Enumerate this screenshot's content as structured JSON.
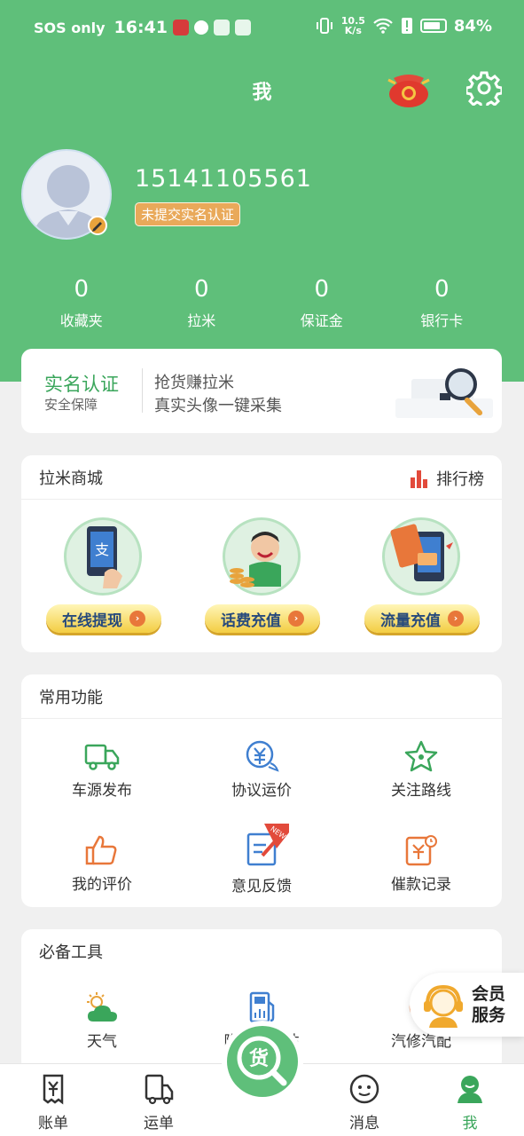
{
  "status_bar": {
    "sos": "SOS only",
    "time": "16:41",
    "net_speed_value": "10.5",
    "net_speed_unit": "K/s",
    "battery_pct": "84%",
    "battery_level": 0.84
  },
  "header": {
    "title": "我"
  },
  "profile": {
    "phone": "15141105561",
    "verify_badge": "未提交实名认证"
  },
  "stats": [
    {
      "value": "0",
      "label": "收藏夹"
    },
    {
      "value": "0",
      "label": "拉米"
    },
    {
      "value": "0",
      "label": "保证金"
    },
    {
      "value": "0",
      "label": "银行卡"
    }
  ],
  "verify_card": {
    "title": "实名认证",
    "subtitle": "安全保障",
    "desc_line1": "抢货赚拉米",
    "desc_line2": "真实头像一键采集"
  },
  "mall": {
    "title": "拉米商城",
    "rank_label": "排行榜",
    "items": [
      {
        "label": "在线提现",
        "icon": "alipay-phone-icon"
      },
      {
        "label": "话费充值",
        "icon": "phone-call-coins-icon"
      },
      {
        "label": "流量充值",
        "icon": "data-card-icon"
      }
    ]
  },
  "functions": {
    "title": "常用功能",
    "items": [
      {
        "label": "车源发布",
        "icon": "truck-icon"
      },
      {
        "label": "协议运价",
        "icon": "yuan-chat-icon"
      },
      {
        "label": "关注路线",
        "icon": "star-icon"
      },
      {
        "label": "我的评价",
        "icon": "thumbs-up-icon"
      },
      {
        "label": "意见反馈",
        "icon": "feedback-icon",
        "badge": "NEW"
      },
      {
        "label": "催款记录",
        "icon": "payment-clock-icon"
      }
    ]
  },
  "tools": {
    "title": "必备工具",
    "items": [
      {
        "label": "天气",
        "icon": "weather-icon"
      },
      {
        "label": "附近加油站",
        "icon": "gas-station-icon"
      },
      {
        "label": "汽修汽配",
        "icon": "repair-icon"
      }
    ]
  },
  "member_service": {
    "line1": "会员",
    "line2": "服务"
  },
  "tabbar": {
    "items": [
      {
        "label": "账单",
        "icon": "bill-icon"
      },
      {
        "label": "运单",
        "icon": "truck-doc-icon"
      },
      {
        "label": "消息",
        "icon": "chat-face-icon"
      },
      {
        "label": "我",
        "icon": "profile-icon",
        "active": true
      }
    ],
    "center_glyph": "货"
  },
  "colors": {
    "brand_green": "#5fbf7a",
    "accent_orange": "#e8773a",
    "icon_green": "#3aa65b",
    "icon_blue": "#3f7fd0"
  }
}
